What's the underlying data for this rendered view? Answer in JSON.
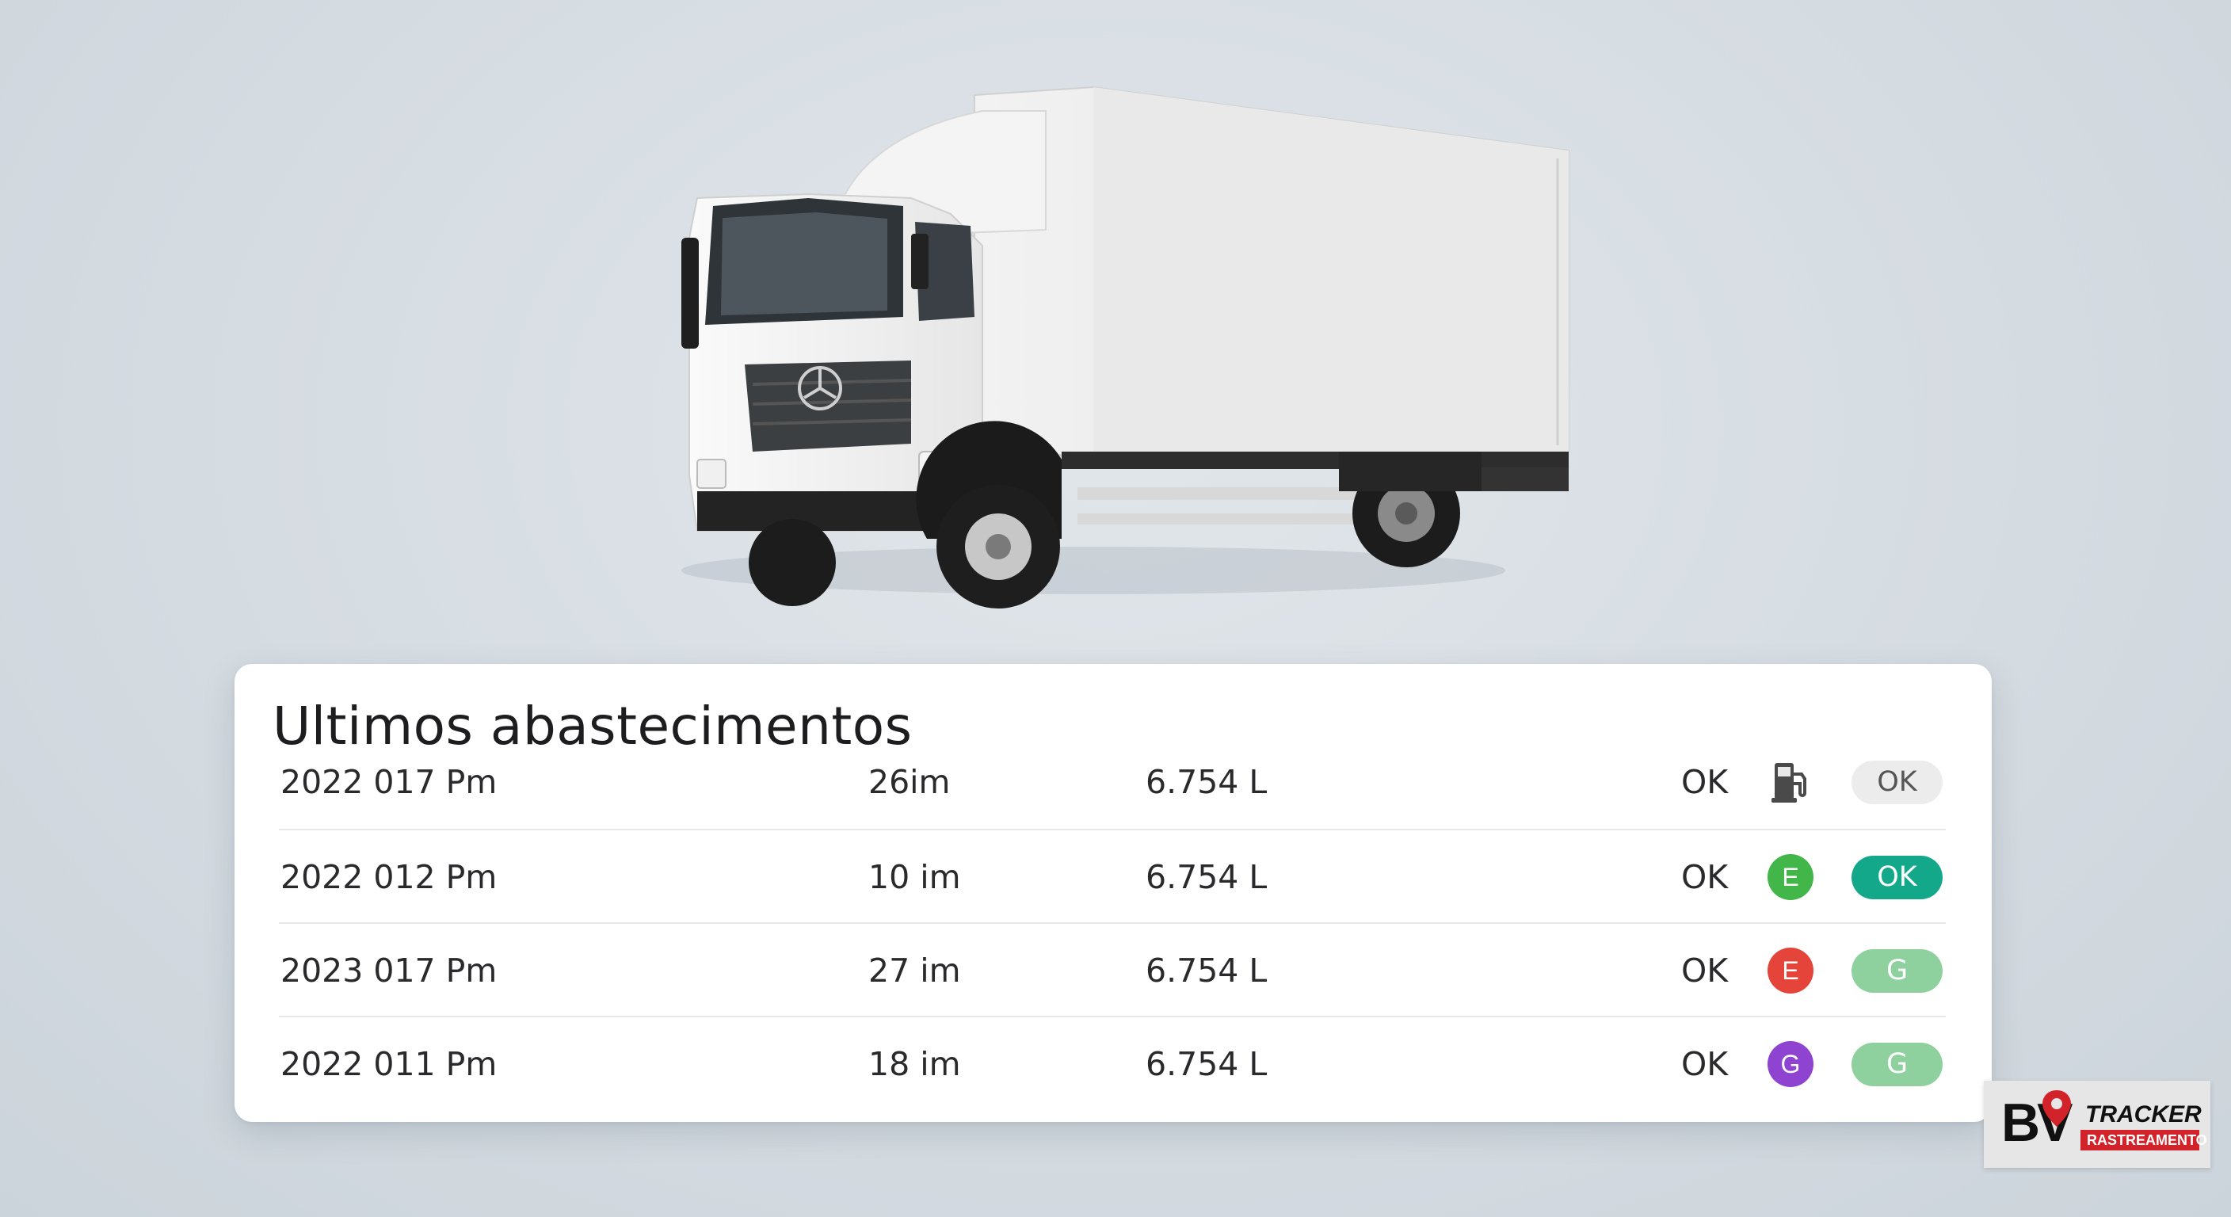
{
  "panel": {
    "title": "Ultimos abastecimentos",
    "rows": [
      {
        "date": "2022 017 Pm",
        "duration": "26im",
        "volume": "6.754 L",
        "status": "OK",
        "icon": {
          "type": "fuel-pump-icon",
          "label": ""
        },
        "badge": {
          "label": "OK",
          "bg": "#ececec",
          "fg": "#555555"
        }
      },
      {
        "date": "2022 012 Pm",
        "duration": "10 im",
        "volume": "6.754 L",
        "status": "OK",
        "icon": {
          "type": "letter-circle",
          "label": "E",
          "color": "#43b649"
        },
        "badge": {
          "label": "OK",
          "bg": "#13a88a",
          "fg": "#ffffff"
        }
      },
      {
        "date": "2023 017 Pm",
        "duration": "27 im",
        "volume": "6.754 L",
        "status": "OK",
        "icon": {
          "type": "letter-circle",
          "label": "E",
          "color": "#e4443a"
        },
        "badge": {
          "label": "G",
          "bg": "#8fd19e",
          "fg": "#ffffff"
        }
      },
      {
        "date": "2022 011 Pm",
        "duration": "18 im",
        "volume": "6.754 L",
        "status": "OK",
        "icon": {
          "type": "letter-circle",
          "label": "G",
          "color": "#8e44d1"
        },
        "badge": {
          "label": "G",
          "bg": "#8fd19e",
          "fg": "#ffffff"
        }
      }
    ]
  },
  "logo": {
    "main": "BV",
    "tracker": "TRACKER",
    "sub": "RASTREAMENTO",
    "accent": "#d3232a"
  }
}
